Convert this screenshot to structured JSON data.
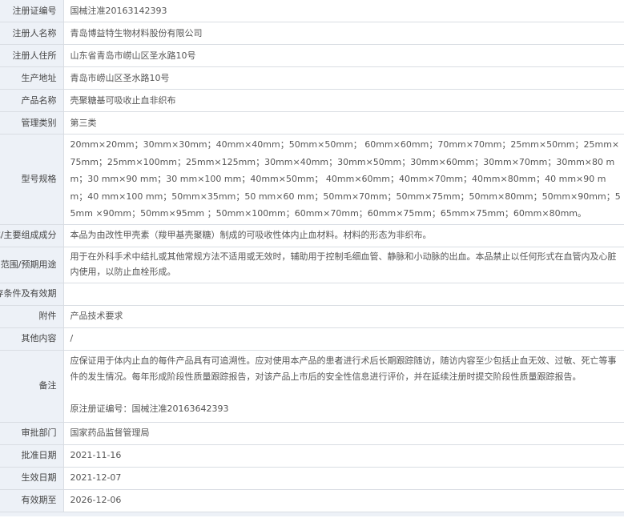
{
  "rows": {
    "reg_no": {
      "label": "注册证编号",
      "value": "国械注准20163142393"
    },
    "registrant": {
      "label": "注册人名称",
      "value": "青岛博益特生物材料股份有限公司"
    },
    "address": {
      "label": "注册人住所",
      "value": "山东省青岛市崂山区圣水路10号"
    },
    "production": {
      "label": "生产地址",
      "value": "青岛市崂山区圣水路10号"
    },
    "product_name": {
      "label": "产品名称",
      "value": "壳聚糖基可吸收止血非织布"
    },
    "class": {
      "label": "管理类别",
      "value": "第三类"
    },
    "model": {
      "label": "型号规格",
      "value": "20mm×20mm；30mm×30mm；40mm×40mm；50mm×50mm； 60mm×60mm；70mm×70mm；25mm×50mm；25mm×75mm；25mm×100mm；25mm×125mm；30mm×40mm；30mm×50mm；30mm×60mm；30mm×70mm；30mm×80 mm；30 mm×90 mm；30 mm×100 mm；40mm×50mm； 40mm×60mm；40mm×70mm；40mm×80mm；40 mm×90 m m；40 mm×100 mm；50mm×35mm；50 mm×60 mm；50mm×70mm；50mm×75mm；50mm×80mm；50mm×90mm；55mm ×90mm；50mm×95mm ；50mm×100mm；60mm×70mm；60mm×75mm；65mm×75mm；60mm×80mm。"
    },
    "composition": {
      "label": "结构及组成/主要组成成分",
      "value": "本品为由改性甲壳素（羧甲基壳聚糖）制成的可吸收性体内止血材料。材料的形态为非织布。"
    },
    "intended_use": {
      "label": "适用范围/预期用途",
      "value": "用于在外科手术中结扎或其他常规方法不适用或无效时，辅助用于控制毛细血管、静脉和小动脉的出血。本品禁止以任何形式在血管内及心脏内使用，以防止血栓形成。"
    },
    "storage": {
      "label": "产品储存条件及有效期",
      "value": ""
    },
    "attachment": {
      "label": "附件",
      "value": "产品技术要求"
    },
    "other": {
      "label": "其他内容",
      "value": "/"
    },
    "remarks": {
      "label": "备注",
      "value": "应保证用于体内止血的每件产品具有可追溯性。应对使用本产品的患者进行术后长期跟踪随访，随访内容至少包括止血无效、过敏、死亡等事件的发生情况。每年形成阶段性质量跟踪报告，对该产品上市后的安全性信息进行评价，并在延续注册时提交阶段性质量跟踪报告。",
      "original_reg": "原注册证编号：国械注准20163642393"
    },
    "authority": {
      "label": "审批部门",
      "value": "国家药品监督管理局"
    },
    "approval_date": {
      "label": "批准日期",
      "value": "2021-11-16"
    },
    "effective_date": {
      "label": "生效日期",
      "value": "2021-12-07"
    },
    "expiry_date": {
      "label": "有效期至",
      "value": "2026-12-06"
    }
  }
}
